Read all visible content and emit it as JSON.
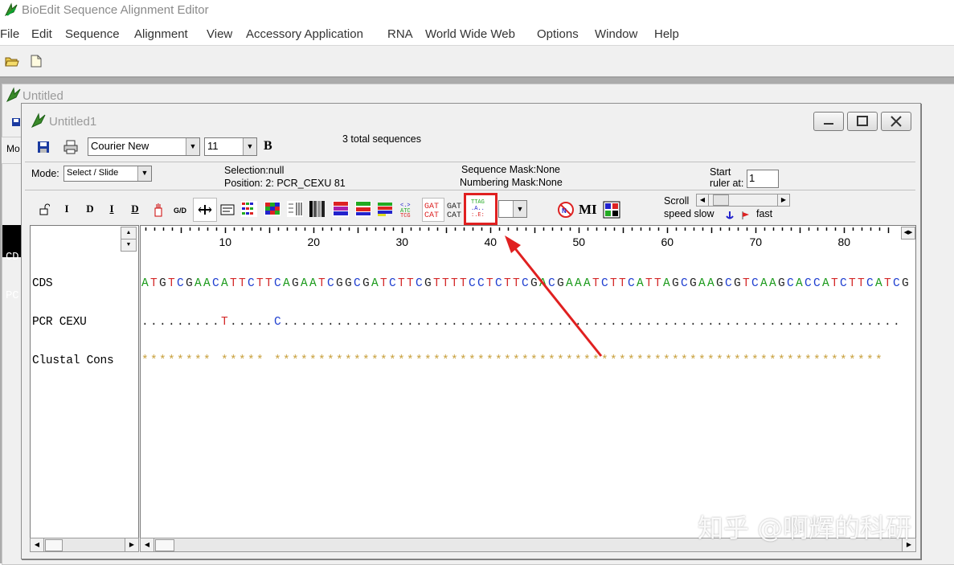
{
  "app": {
    "title": "BioEdit Sequence Alignment Editor"
  },
  "menu": [
    "File",
    "Edit",
    "Sequence",
    "Alignment",
    "View",
    "Accessory Application",
    "RNA",
    "World Wide Web",
    "Options",
    "Window",
    "Help"
  ],
  "bg_window": {
    "title": "Untitled",
    "left_partial_1": "Mo",
    "seq_partial_1": "CD",
    "seq_partial_2": "PC"
  },
  "window": {
    "title": "Untitled1",
    "font_name": "Courier New",
    "font_size": "11",
    "bold_label": "B",
    "total_sequences": "3 total sequences",
    "mode_label": "Mode:",
    "mode_value": "Select / Slide",
    "selection": "Selection:null",
    "position": "Position:  2: PCR_CEXU 81",
    "sequence_mask": "Sequence Mask:None",
    "numbering_mask": "Numbering Mask:None",
    "start_label": "Start",
    "ruler_label": "ruler at:",
    "ruler_value": "1",
    "scroll_label": "Scroll",
    "speed_slow": "speed slow",
    "fast_label": "fast",
    "mi_label": "MI"
  },
  "tools": {
    "i": "I",
    "d": "D",
    "i_bar": "I",
    "d_bar": "D",
    "gd": "G/D",
    "consensus_icon_text": [
      "TTAG",
      ".A..",
      ":.E:"
    ]
  },
  "ruler": [
    10,
    20,
    30,
    40,
    50,
    60,
    70,
    80
  ],
  "sequences": [
    {
      "name": "CDS",
      "seq": "ATGTCGAACATTCTTCAGAATCGGCGATCTTCGTTTTCCTCTTCGACGAAATCTTCATTAGCGAAGCGTCAAGCACCATCTTCATCG"
    },
    {
      "name": "PCR CEXU",
      "seq": ".........T.....C......................................................................"
    },
    {
      "name": "Clustal Cons",
      "seq": "******** ***** *********************************************************************"
    }
  ],
  "colors": {
    "A": "#1a9a1a",
    "T": "#d42a2a",
    "C": "#1f3fd0",
    "G": "#222222",
    "dot": "#2a2a2a",
    "star": "#c8a03c",
    "highlight": "#e02020"
  },
  "watermark": "知乎 @啊辉的科研"
}
